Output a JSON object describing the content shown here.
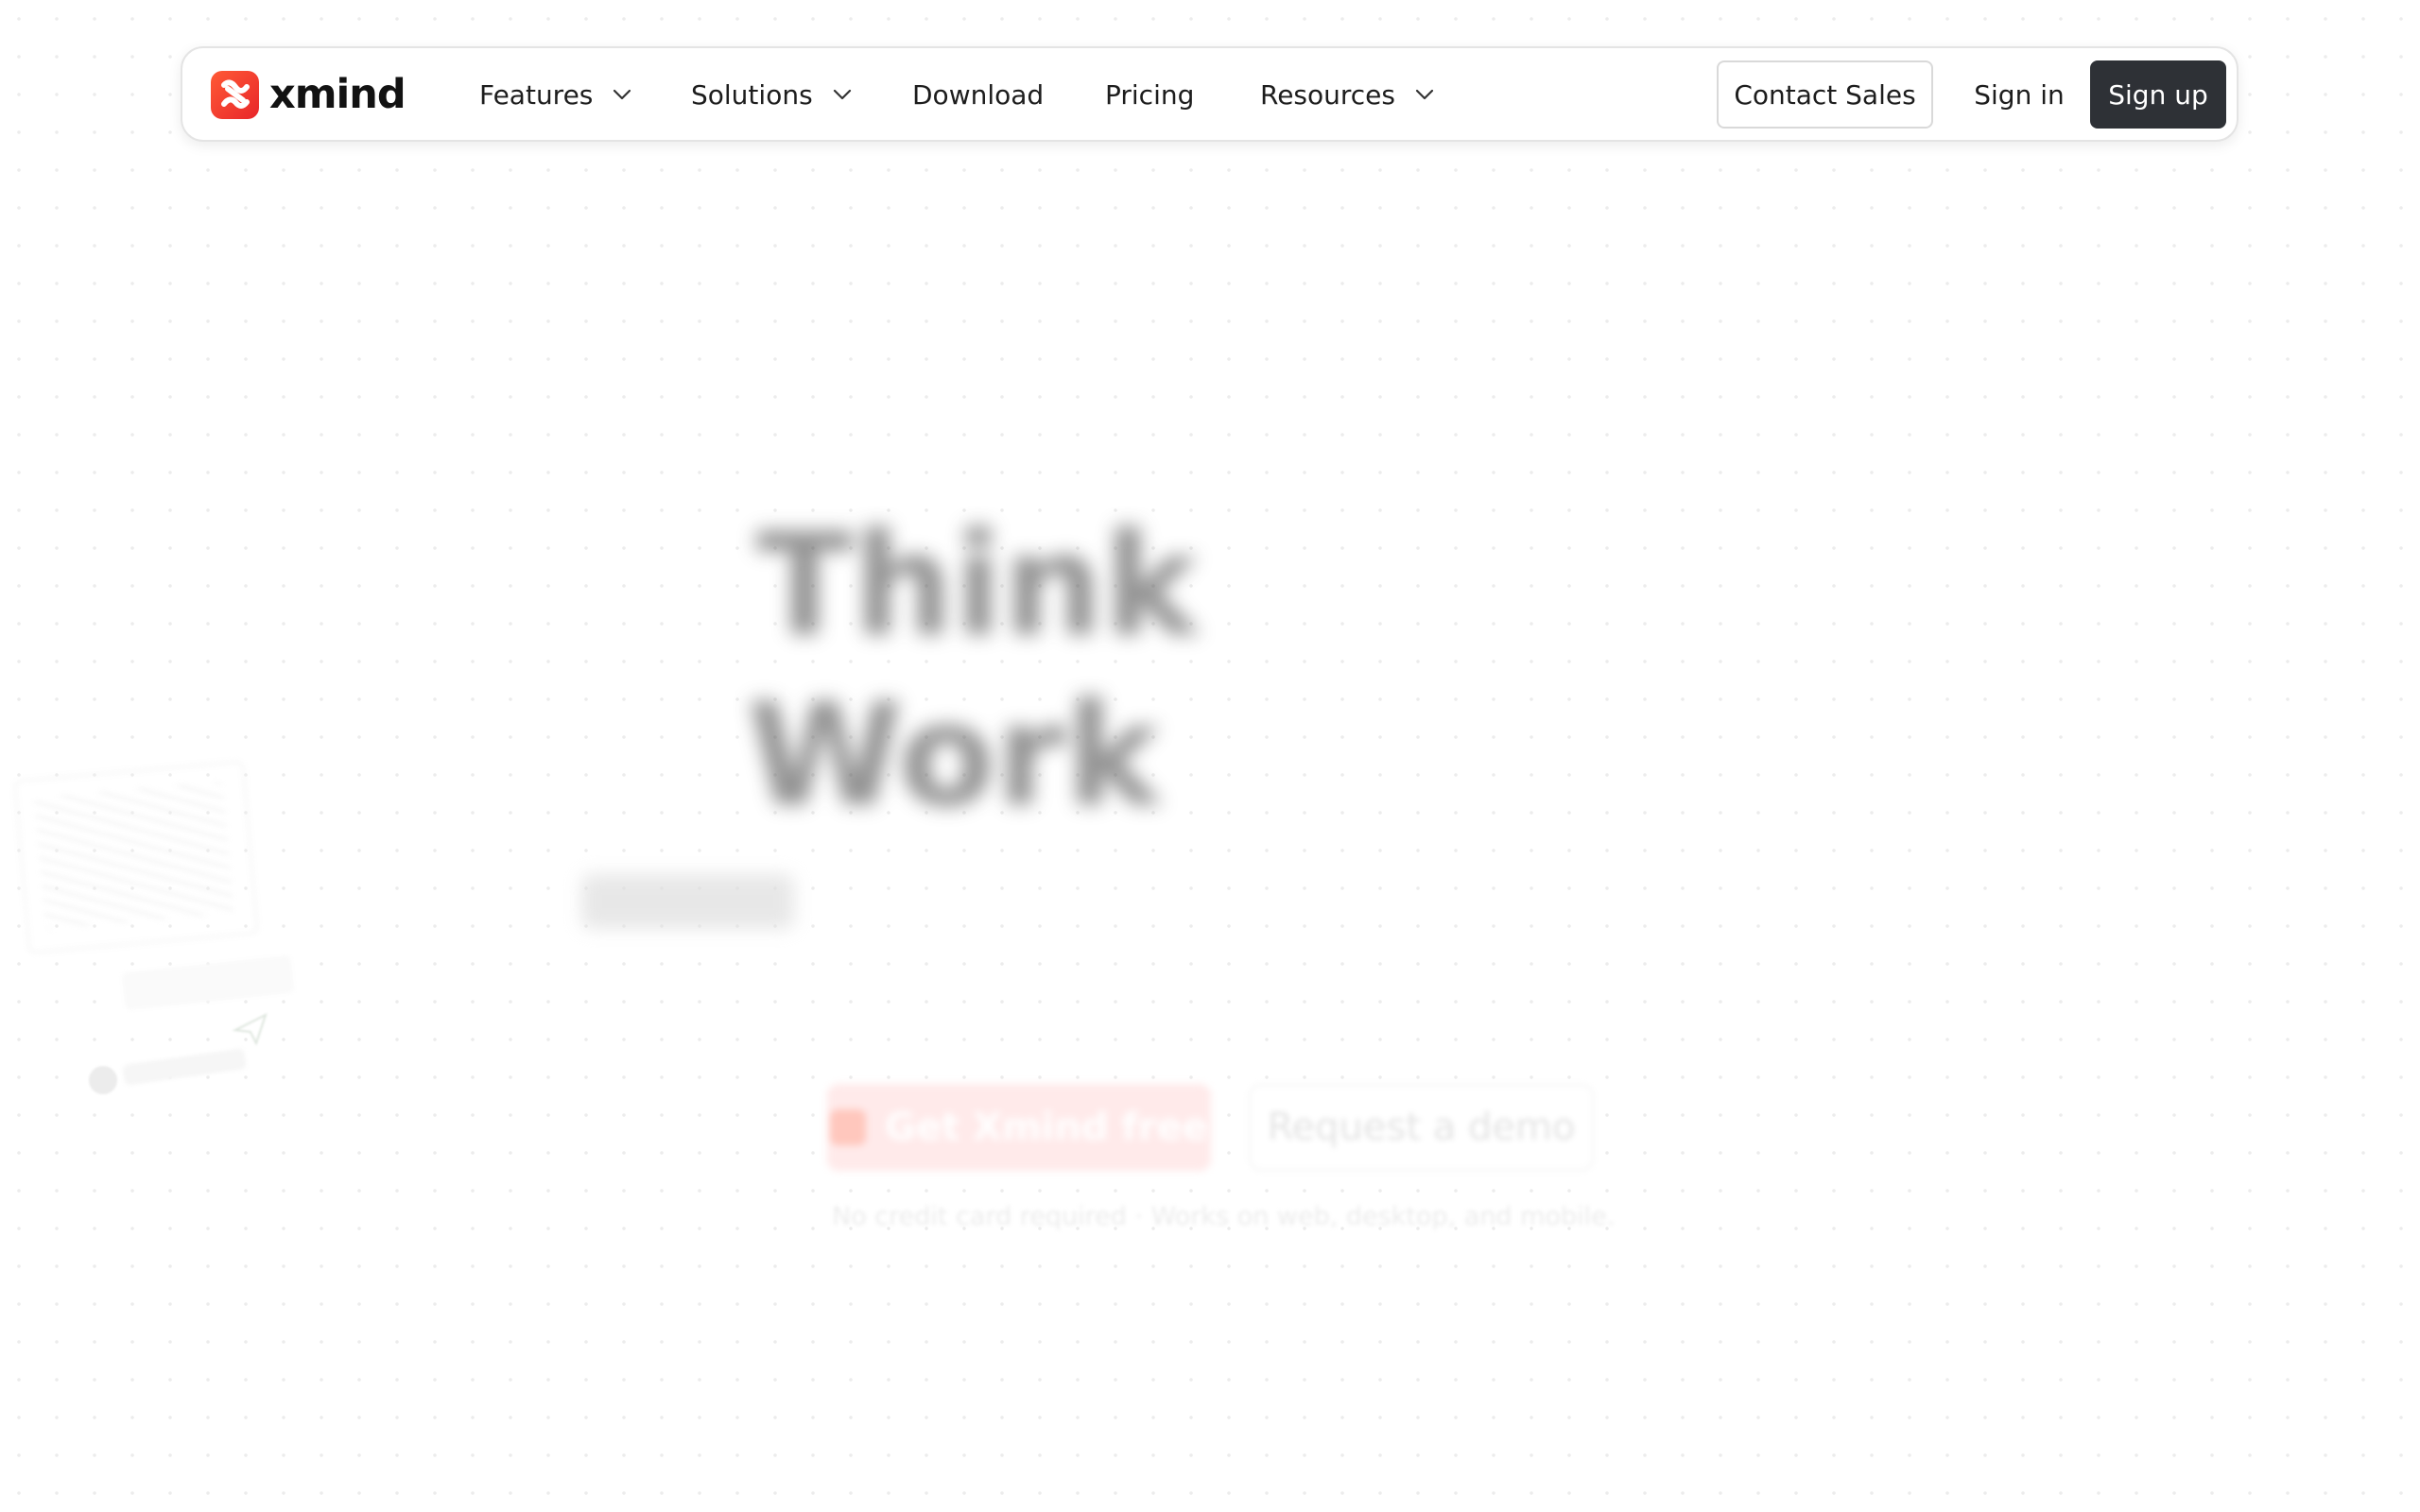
{
  "brand": {
    "name": "xmind",
    "logo_icon": "xmind-logo-icon",
    "accent_color": "#f0332c"
  },
  "nav": {
    "items": [
      {
        "label": "Features",
        "has_dropdown": true
      },
      {
        "label": "Solutions",
        "has_dropdown": true
      },
      {
        "label": "Download",
        "has_dropdown": false
      },
      {
        "label": "Pricing",
        "has_dropdown": false
      },
      {
        "label": "Resources",
        "has_dropdown": true
      }
    ],
    "contact_sales": "Contact Sales",
    "sign_in": "Sign in",
    "sign_up": "Sign up",
    "sign_up_bg": "#2e3136"
  },
  "hero": {
    "headline_line1": "Think",
    "headline_line2": "Work",
    "cta_primary": "Get Xmind free",
    "cta_secondary": "Request a demo",
    "note": "No credit card required · Works on web, desktop, and mobile."
  }
}
